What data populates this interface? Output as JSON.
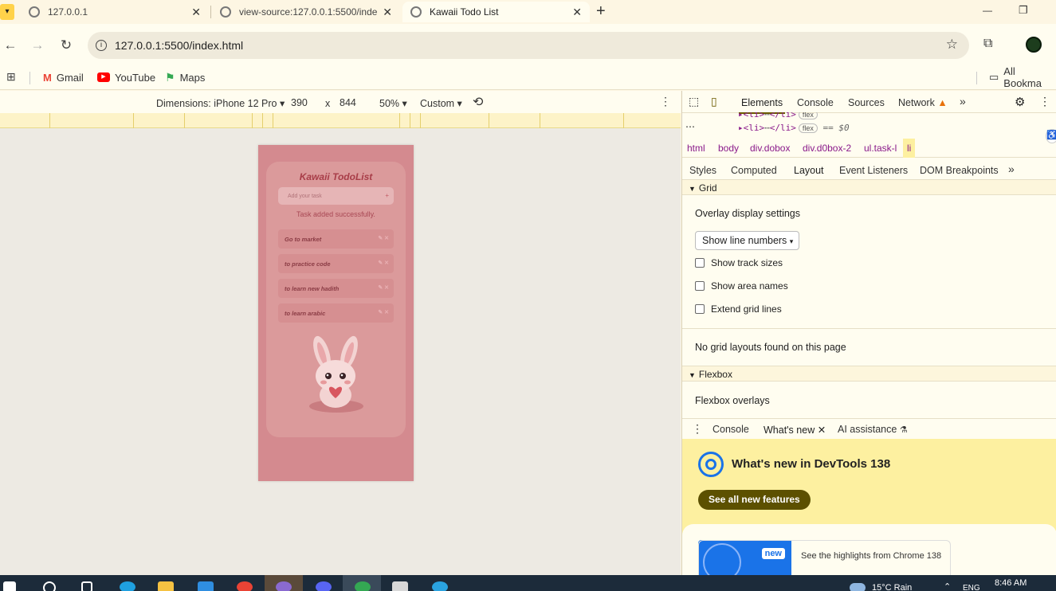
{
  "tabs": [
    {
      "title": "127.0.0.1",
      "close": "✕"
    },
    {
      "title": "view-source:127.0.0.1:5500/inde",
      "close": "✕"
    },
    {
      "title": "Kawaii Todo List",
      "close": "✕"
    }
  ],
  "new_tab": "+",
  "window_controls": {
    "minimize": "—",
    "restore": "❐"
  },
  "address": {
    "url": "127.0.0.1:5500/index.html"
  },
  "bookmarks": [
    {
      "label": "Gmail",
      "color": "#ea4335"
    },
    {
      "label": "YouTube",
      "color": "#ff0000"
    },
    {
      "label": "Maps",
      "color": "#34a853"
    }
  ],
  "bookmarks_folder": "All Bookma",
  "device_toolbar": {
    "dimensions": "Dimensions: iPhone 12 Pro",
    "width": "390",
    "times": "x",
    "height": "844",
    "zoom": "50%",
    "throttle": "Custom"
  },
  "app": {
    "title": "Kawaii TodoList",
    "input_placeholder": "Add your task",
    "add_symbol": "+",
    "message": "Task added successfully.",
    "tasks": [
      "Go to market",
      "to practice code",
      "to learn new hadith",
      "to learn arabic"
    ],
    "task_icons": "✎ ✕",
    "colors": {
      "page": "#d48a8f",
      "card": "#db9a9b",
      "accent": "#a83d48"
    }
  },
  "devtools": {
    "tabs": [
      "Elements",
      "Console",
      "Sources",
      "Network"
    ],
    "more": "»",
    "dom": [
      {
        "text": "<li>",
        "dots": "⋯",
        "close": "</li>",
        "pill": "flex"
      },
      {
        "text": "<li>",
        "dots": "⋯",
        "close": "</li>",
        "pill": "flex",
        "suffix": "== $0"
      }
    ],
    "breadcrumbs": [
      "html",
      "body",
      "div.dobox",
      "div.d0box-2",
      "ul.task-l",
      "li"
    ],
    "subtabs": [
      "Styles",
      "Computed",
      "Layout",
      "Event Listeners",
      "DOM Breakpoints"
    ],
    "grid": {
      "header": "Grid",
      "overlay_title": "Overlay display settings",
      "select": "Show line numbers",
      "checkboxes": [
        "Show track sizes",
        "Show area names",
        "Extend grid lines"
      ],
      "empty": "No grid layouts found on this page"
    },
    "flexbox": {
      "header": "Flexbox",
      "overlays": "Flexbox overlays"
    },
    "drawer_tabs": [
      "Console",
      "What's new",
      "AI assistance"
    ],
    "whats_new": {
      "title": "What's new in DevTools 138",
      "button": "See all new features",
      "badge": "new",
      "highlight": "See the highlights from Chrome 138"
    }
  },
  "taskbar": {
    "weather": "15°C  Rain",
    "lang": "ENG",
    "time": "8:46 AM"
  }
}
